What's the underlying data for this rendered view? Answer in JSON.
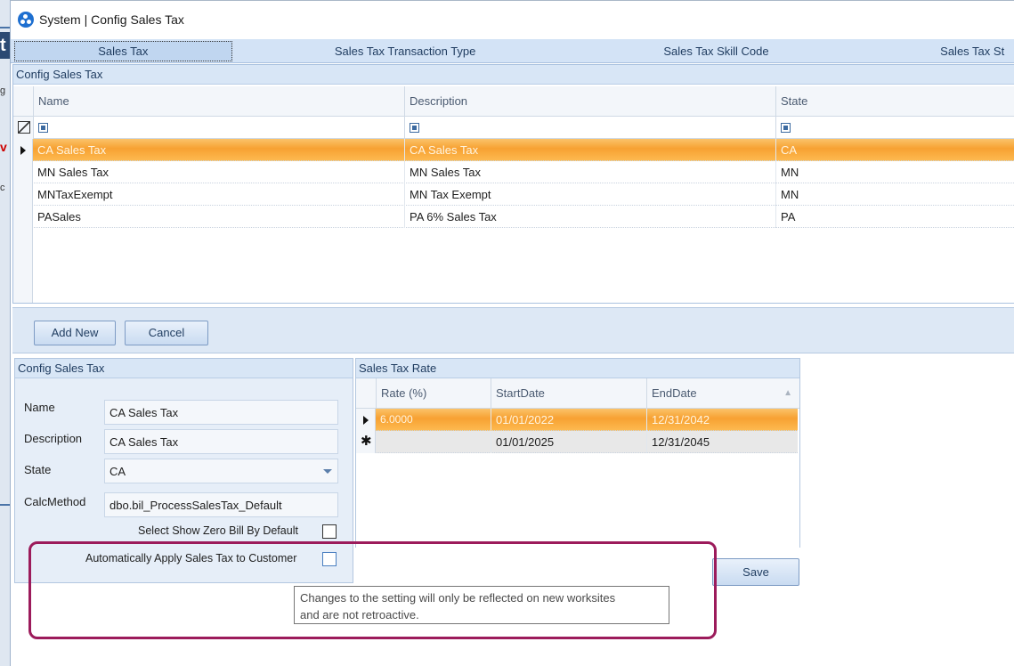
{
  "window": {
    "title": "System | Config Sales Tax",
    "background_letters": [
      "t",
      "g",
      "v",
      "c"
    ]
  },
  "tabs": [
    {
      "label": "Sales Tax",
      "active": true
    },
    {
      "label": "Sales Tax Transaction Type",
      "active": false
    },
    {
      "label": "Sales Tax Skill Code",
      "active": false
    },
    {
      "label": "Sales Tax St",
      "active": false
    }
  ],
  "grid": {
    "caption": "Config Sales Tax",
    "columns": [
      "Name",
      "Description",
      "State"
    ],
    "rows": [
      {
        "name": "CA Sales Tax",
        "description": "CA Sales Tax",
        "state": "CA",
        "selected": true
      },
      {
        "name": "MN Sales Tax",
        "description": "MN Sales Tax",
        "state": "MN",
        "selected": false
      },
      {
        "name": "MNTaxExempt",
        "description": "MN Tax Exempt",
        "state": "MN",
        "selected": false
      },
      {
        "name": "PASales",
        "description": "PA 6% Sales Tax",
        "state": "PA",
        "selected": false
      }
    ]
  },
  "buttons": {
    "add_new": "Add New",
    "cancel": "Cancel",
    "save": "Save"
  },
  "form": {
    "caption": "Config Sales Tax",
    "name_label": "Name",
    "name_value": "CA Sales Tax",
    "description_label": "Description",
    "description_value": "CA Sales Tax",
    "state_label": "State",
    "state_value": "CA",
    "calc_label": "CalcMethod",
    "calc_value": "dbo.bil_ProcessSalesTax_Default",
    "zero_bill_label": "Select Show Zero Bill By Default",
    "zero_bill_checked": false,
    "auto_apply_label": "Automatically Apply Sales Tax to Customer",
    "auto_apply_checked": false
  },
  "rates": {
    "caption": "Sales Tax Rate",
    "columns": [
      "Rate (%)",
      "StartDate",
      "EndDate"
    ],
    "rows": [
      {
        "rate": "6.0000",
        "start": "01/01/2022",
        "end": "12/31/2042",
        "selected": true
      },
      {
        "rate": "",
        "start": "01/01/2025",
        "end": "12/31/2045",
        "selected": false
      }
    ]
  },
  "tooltip": {
    "line1": "Changes to the setting will only be reflected on new worksites",
    "line2": "and are not retroactive."
  },
  "colors": {
    "selection_orange": "#f7a132",
    "highlight_border": "#9c1b5b",
    "app_icon_blue": "#1e6fd0"
  }
}
